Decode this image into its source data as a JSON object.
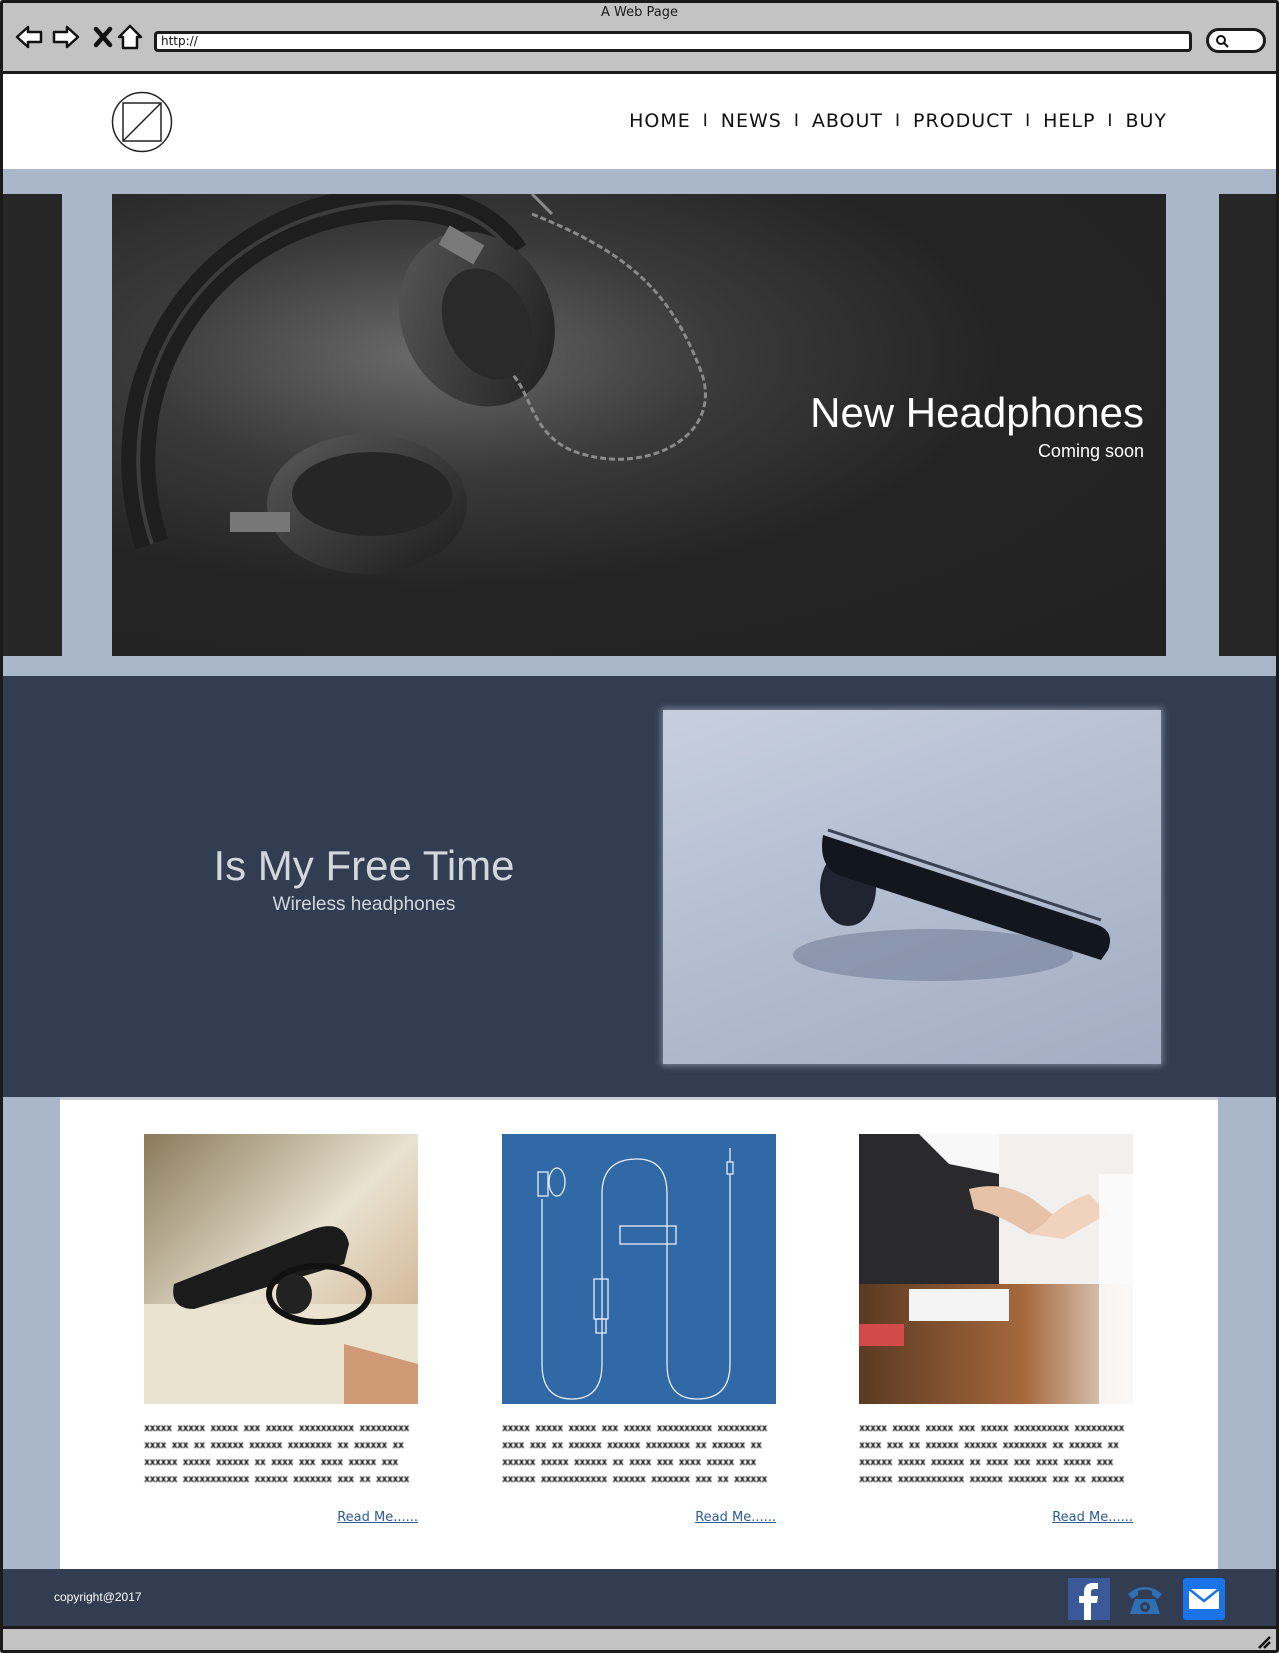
{
  "browser": {
    "window_title": "A Web Page",
    "url": "http://"
  },
  "nav": {
    "items": [
      "HOME",
      "NEWS",
      "ABOUT",
      "PRODUCT",
      "HELP",
      "BUY"
    ],
    "separator": "I"
  },
  "hero": {
    "title": "New Headphones",
    "subtitle": "Coming soon"
  },
  "feature": {
    "title": "Is My Free Time",
    "subtitle": "Wireless headphones"
  },
  "cards": [
    {
      "image": "bluetooth-earpiece-photo",
      "text": "xxxxx xxxxx xxxxx xxx xxxxx xxxxxxxxxx xxxxxxxxx xxxx xxx xx xxxxxx xxxxxx xxxxxxxx xx xxxxxx xx xxxxxx xxxxx xxxxxx xx xxxx xxx xxxx xxxxx xxx xxxxxx xxxxxxxxxxxx xxxxxx xxxxxxx xxx xx xxxxxx",
      "link": "Read Me......"
    },
    {
      "image": "earphones-blueprint",
      "text": "xxxxx xxxxx xxxxx xxx xxxxx xxxxxxxxxx xxxxxxxxx xxxx xxx xx xxxxxx xxxxxx xxxxxxxx xx xxxxxx xx xxxxxx xxxxx xxxxxx xx xxxx xxx xxxx xxxxx xxx xxxxxx xxxxxxxxxxxx xxxxxx xxxxxxx xxx xx xxxxxx",
      "link": "Read Me......"
    },
    {
      "image": "handshake-photo",
      "text": "xxxxx xxxxx xxxxx xxx xxxxx xxxxxxxxxx xxxxxxxxx xxxx xxx xx xxxxxx xxxxxx xxxxxxxx xx xxxxxx xx xxxxxx xxxxx xxxxxx xx xxxx xxx xxxx xxxxx xxx xxxxxx xxxxxxxxxxxx xxxxxx xxxxxxx xxx xx xxxxxx",
      "link": "Read Me......"
    }
  ],
  "footer": {
    "copyright": "copyright@2017",
    "social": [
      "facebook-icon",
      "phone-icon",
      "mail-icon"
    ]
  },
  "colors": {
    "band": "#aab6c9",
    "dark_navy": "#323d51",
    "link": "#2d5a96",
    "blueprint": "#3168a6",
    "facebook": "#3b5998",
    "mail": "#1a73e8"
  }
}
